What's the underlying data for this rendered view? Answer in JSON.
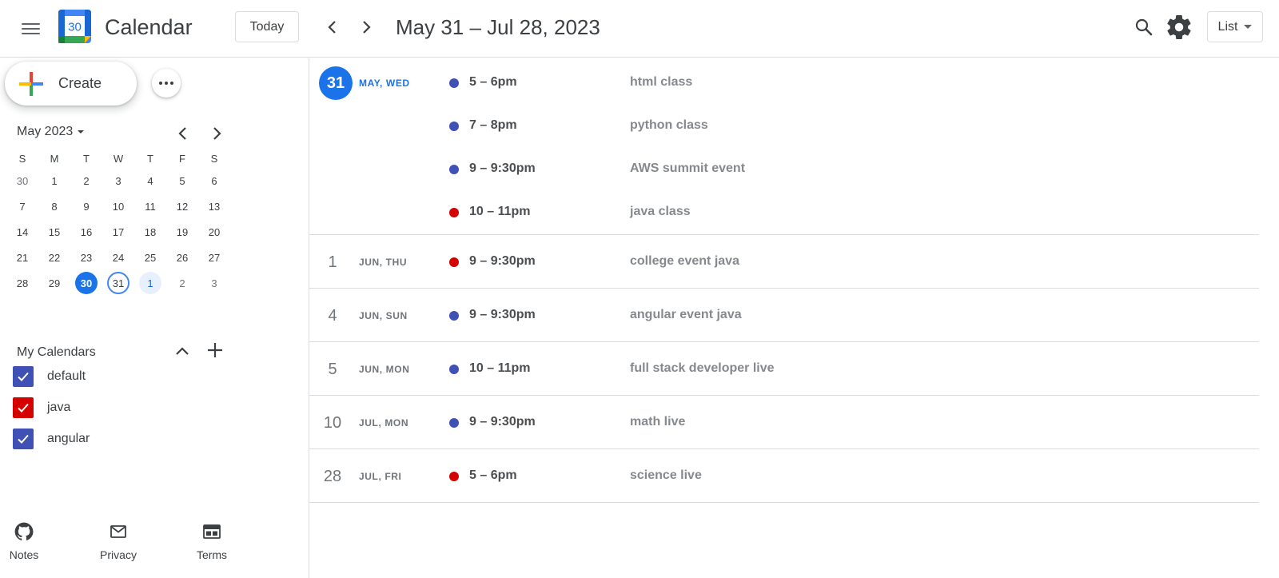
{
  "header": {
    "app_title": "Calendar",
    "logo_day": "30",
    "today_label": "Today",
    "date_range": "May 31 – Jul 28, 2023",
    "view_label": "List"
  },
  "sidebar": {
    "create_label": "Create",
    "mini_calendar": {
      "month_label": "May 2023",
      "weekdays": [
        "S",
        "M",
        "T",
        "W",
        "T",
        "F",
        "S"
      ],
      "weeks": [
        [
          "30",
          "1",
          "2",
          "3",
          "4",
          "5",
          "6"
        ],
        [
          "7",
          "8",
          "9",
          "10",
          "11",
          "12",
          "13"
        ],
        [
          "14",
          "15",
          "16",
          "17",
          "18",
          "19",
          "20"
        ],
        [
          "21",
          "22",
          "23",
          "24",
          "25",
          "26",
          "27"
        ],
        [
          "28",
          "29",
          "30",
          "31",
          "1",
          "2",
          "3"
        ]
      ]
    },
    "my_calendars": {
      "title": "My Calendars",
      "items": [
        {
          "name": "default",
          "color": "#3f51b5"
        },
        {
          "name": "java",
          "color": "#d50000"
        },
        {
          "name": "angular",
          "color": "#3f51b5"
        }
      ]
    },
    "footer": [
      {
        "label": "Notes",
        "icon": "github-icon"
      },
      {
        "label": "Privacy",
        "icon": "mail-icon"
      },
      {
        "label": "Terms",
        "icon": "terms-icon"
      }
    ]
  },
  "colors": {
    "accent": "#1a73e8",
    "blue_event": "#3f51b5",
    "red_event": "#d50000"
  },
  "days": [
    {
      "day": "31",
      "label": "MAY, WED",
      "today": true,
      "events": [
        {
          "time": "5 – 6pm",
          "title": "html class",
          "color": "#3f51b5"
        },
        {
          "time": "7 – 8pm",
          "title": "python class",
          "color": "#3f51b5"
        },
        {
          "time": "9 – 9:30pm",
          "title": "AWS summit event",
          "color": "#3f51b5"
        },
        {
          "time": "10 – 11pm",
          "title": "java class",
          "color": "#d50000"
        }
      ]
    },
    {
      "day": "1",
      "label": "JUN, THU",
      "events": [
        {
          "time": "9 – 9:30pm",
          "title": "college event java",
          "color": "#d50000"
        }
      ]
    },
    {
      "day": "4",
      "label": "JUN, SUN",
      "events": [
        {
          "time": "9 – 9:30pm",
          "title": "angular event java",
          "color": "#3f51b5"
        }
      ]
    },
    {
      "day": "5",
      "label": "JUN, MON",
      "events": [
        {
          "time": "10 – 11pm",
          "title": "full stack developer live",
          "color": "#3f51b5"
        }
      ]
    },
    {
      "day": "10",
      "label": "JUL, MON",
      "events": [
        {
          "time": "9 – 9:30pm",
          "title": "math live",
          "color": "#3f51b5"
        }
      ]
    },
    {
      "day": "28",
      "label": "JUL, FRI",
      "events": [
        {
          "time": "5 – 6pm",
          "title": "science live",
          "color": "#d50000"
        }
      ]
    }
  ]
}
